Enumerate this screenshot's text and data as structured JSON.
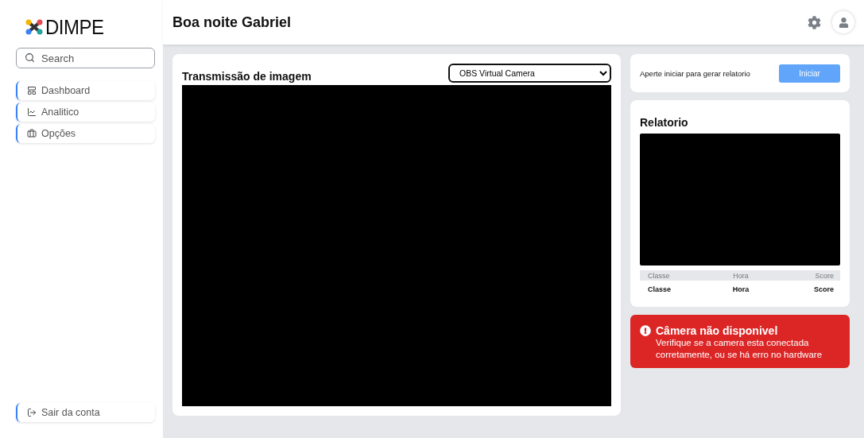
{
  "sidebar": {
    "logo": "DIMPE",
    "search": {
      "placeholder": "Search"
    },
    "items": [
      {
        "label": "Dashboard"
      },
      {
        "label": "Analitico"
      },
      {
        "label": "Opções"
      }
    ],
    "logout": {
      "label": "Sair da conta"
    }
  },
  "header": {
    "greeting": "Boa noite Gabriel"
  },
  "stream": {
    "title": "Transmissão de imagem",
    "camera_select": "OBS Virtual Camera"
  },
  "start": {
    "text": "Aperte iniciar para gerar relatorio",
    "button": "Iniciar"
  },
  "report": {
    "title": "Relatorio",
    "columns": [
      "Classe",
      "Hora",
      "Score"
    ],
    "rows": [
      [
        "Classe",
        "Hora",
        "Score"
      ]
    ]
  },
  "alert": {
    "title": "Câmera não disponivel",
    "message": "Verifique se a camera esta conectada corretamente, ou se há erro no hardware"
  }
}
